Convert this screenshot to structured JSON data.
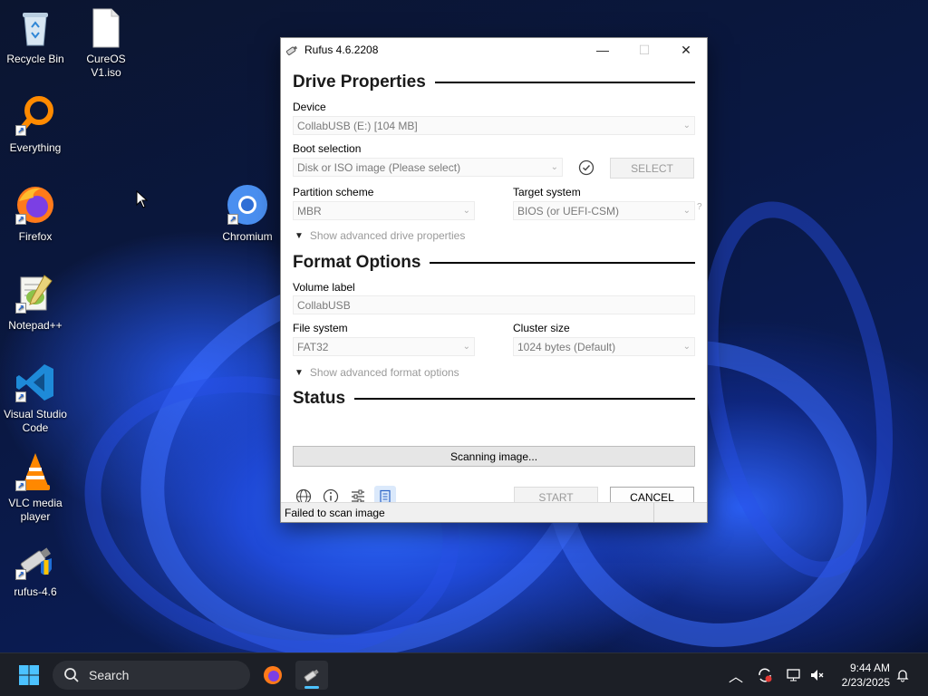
{
  "desktop": {
    "icons": [
      {
        "label": "Recycle Bin",
        "name": "recycle-bin-icon"
      },
      {
        "label": "CureOS V1.iso",
        "name": "file-icon"
      },
      {
        "label": "Everything",
        "name": "everything-icon"
      },
      {
        "label": "Firefox",
        "name": "firefox-icon"
      },
      {
        "label": "Chromium",
        "name": "chromium-icon"
      },
      {
        "label": "Notepad++",
        "name": "notepad-plus-plus-icon"
      },
      {
        "label": "Visual Studio Code",
        "name": "vscode-icon"
      },
      {
        "label": "VLC media player",
        "name": "vlc-icon"
      },
      {
        "label": "rufus-4.6",
        "name": "rufus-icon"
      }
    ]
  },
  "window": {
    "title": "Rufus 4.6.2208",
    "controls": {
      "minimize": "—",
      "maximize": "☐",
      "close": "✕"
    },
    "drive_properties": {
      "heading": "Drive Properties",
      "device_label": "Device",
      "device_value": "CollabUSB (E:) [104 MB]",
      "boot_label": "Boot selection",
      "boot_value": "Disk or ISO image (Please select)",
      "select_button": "SELECT",
      "partition_label": "Partition scheme",
      "partition_value": "MBR",
      "target_label": "Target system",
      "target_value": "BIOS (or UEFI-CSM)",
      "help_mark": "?",
      "advanced_toggle": "Show advanced drive properties"
    },
    "format_options": {
      "heading": "Format Options",
      "volume_label_label": "Volume label",
      "volume_label_value": "CollabUSB",
      "filesystem_label": "File system",
      "filesystem_value": "FAT32",
      "cluster_label": "Cluster size",
      "cluster_value": "1024 bytes (Default)",
      "advanced_toggle": "Show advanced format options"
    },
    "status": {
      "heading": "Status",
      "progress_text": "Scanning image...",
      "start_button": "START",
      "cancel_button": "CANCEL"
    },
    "statusbar": {
      "message": "Failed to scan image"
    }
  },
  "taskbar": {
    "search_placeholder": "Search",
    "time": "9:44 AM",
    "date": "2/23/2025"
  }
}
